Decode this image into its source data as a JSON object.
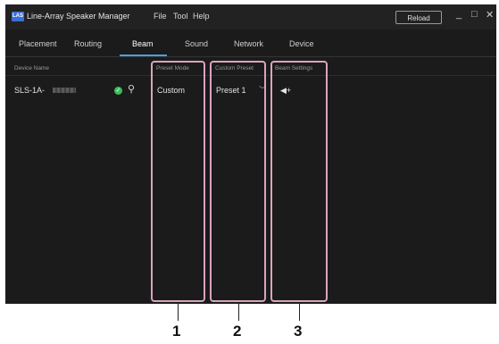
{
  "app": {
    "logo": "LAS",
    "title": "Line-Array Speaker Manager",
    "menu": [
      "File",
      "Tool",
      "Help"
    ],
    "reload_label": "Reload",
    "minimize_glyph": "_",
    "maximize_glyph": "□",
    "close_glyph": "✕"
  },
  "tabs": [
    {
      "label": "Placement"
    },
    {
      "label": "Routing"
    },
    {
      "label": "Beam",
      "active": true
    },
    {
      "label": "Sound"
    },
    {
      "label": "Network"
    },
    {
      "label": "Device"
    }
  ],
  "table": {
    "headers": [
      "Device Name",
      "Preset Mode",
      "Custom Preset",
      "Beam Settings"
    ],
    "rows": [
      {
        "device_name": "SLS-1A-",
        "status_icon": "check-circle-icon",
        "search_icon": "search-icon",
        "preset_mode": "Custom",
        "custom_preset": "Preset 1",
        "beam_settings_icon": "speaker-icon"
      }
    ]
  },
  "callouts": [
    "1",
    "2",
    "3"
  ],
  "colors": {
    "background": "#1b1b1b",
    "accent": "#4a9fe0",
    "highlight": "#d8a4bd",
    "status_ok": "#3bbf5a"
  }
}
